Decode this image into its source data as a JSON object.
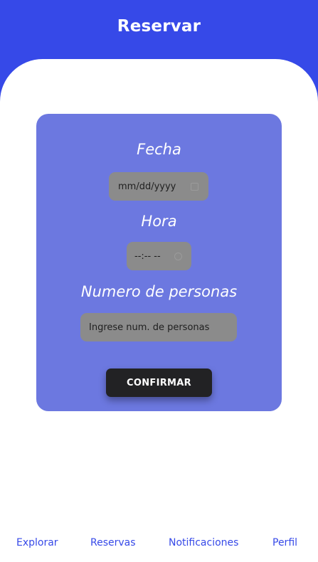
{
  "colors": {
    "header": "#3649e8",
    "card": "#6c78e0",
    "field": "#8b8b8b",
    "button": "#222224",
    "nav_text": "#3649e8"
  },
  "header": {
    "title": "Reservar"
  },
  "form": {
    "fecha_label": "Fecha",
    "fecha_value": "mm/dd/yyyy",
    "hora_label": "Hora",
    "hora_value": "--:-- --",
    "personas_label": "Numero de personas",
    "personas_placeholder": "Ingrese num. de personas",
    "confirm_label": "CONFIRMAR"
  },
  "nav": {
    "items": [
      {
        "label": "Explorar"
      },
      {
        "label": "Reservas"
      },
      {
        "label": "Notificaciones"
      },
      {
        "label": "Perfil"
      }
    ]
  }
}
